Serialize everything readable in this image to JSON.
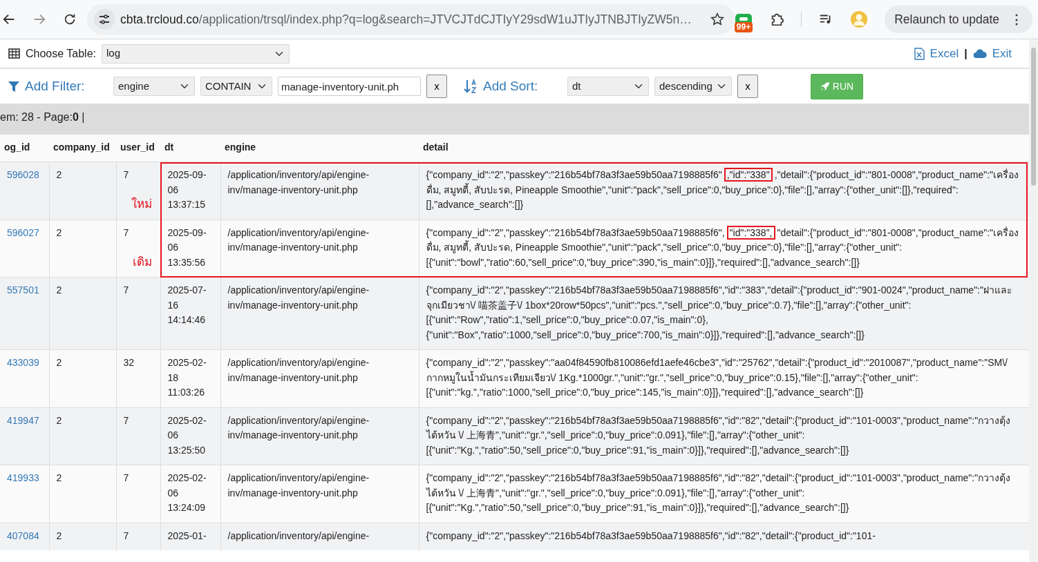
{
  "browser": {
    "url_domain": "cbta.trcloud.co",
    "url_path": "/application/trsql/index.php?q=log&search=JTVCJTdCJTIyY29sdW1uJTIyJTNBJTIyZW5n…",
    "badge": "99+",
    "relaunch_button": "Relaunch to update",
    "menu_glyph": "⋮"
  },
  "toolbar": {
    "choose_table_label": "Choose Table:",
    "table_select": "log",
    "links": [
      {
        "kind": "excel",
        "label": "Excel"
      },
      {
        "kind": "exit",
        "label": "Exit"
      }
    ],
    "separator": "|"
  },
  "filter": {
    "label": "Add Filter:",
    "column": "engine",
    "operator": "CONTAIN",
    "value": "manage-inventory-unit.ph",
    "remove": "x"
  },
  "sort": {
    "label": "Add Sort:",
    "column": "dt",
    "direction": "descending",
    "remove": "x"
  },
  "run_button": "RUN",
  "status": "em: 28 - Page:**0** |",
  "table": {
    "columns": [
      "og_id",
      "company_id",
      "user_id",
      "dt",
      "engine",
      "detail"
    ],
    "rows": [
      {
        "log_id": "596028",
        "company_id": "2",
        "user_id": "7",
        "annotation": "ใหม่",
        "boxed": true,
        "dt": "2025-09-06 13:37:15",
        "engine": "/application/inventory/api/engine-inv/manage-inventory-unit.php",
        "detail": {
          "before": "{\"company_id\":\"2\",\"passkey\":\"216b54bf78a3f3ae59b50aa7198885f6\"",
          "highlight": ",\"id\":\"338\"",
          "after": ",\"detail\":{\"product_id\":\"801-0008\",\"product_name\":\"เครื่องดื่ม, สมูทตี้, สับปะรด, Pineapple Smoothie\",\"unit\":\"pack\",\"sell_price\":0,\"buy_price\":0},\"file\":[],\"array\":{\"other_unit\":[]},\"required\":[],\"advance_search\":[]}"
        }
      },
      {
        "log_id": "596027",
        "company_id": "2",
        "user_id": "7",
        "annotation": "เดิม",
        "boxed": true,
        "dt": "2025-09-06 13:35:56",
        "engine": "/application/inventory/api/engine-inv/manage-inventory-unit.php",
        "detail": {
          "before": "{\"company_id\":\"2\",\"passkey\":\"216b54bf78a3f3ae59b50aa7198885f6\",",
          "highlight": "\"id\":\"338\",",
          "after": "\"detail\":{\"product_id\":\"801-0008\",\"product_name\":\"เครื่องดื่ม, สมูทตี้, สับปะรด, Pineapple Smoothie\",\"unit\":\"pack\",\"sell_price\":0,\"buy_price\":0},\"file\":[],\"array\":{\"other_unit\":[{\"unit\":\"bowl\",\"ratio\":60,\"sell_price\":0,\"buy_price\":390,\"is_main\":0}]},\"required\":[],\"advance_search\":[]}"
        }
      },
      {
        "log_id": "557501",
        "company_id": "2",
        "user_id": "7",
        "boxed": false,
        "dt": "2025-07-16 14:14:46",
        "engine": "/application/inventory/api/engine-inv/manage-inventory-unit.php",
        "detail": {
          "before": "{\"company_id\":\"2\",\"passkey\":\"216b54bf78a3f3ae59b50aa7198885f6\",\"id\":\"383\",\"detail\":{\"product_id\":\"901-0024\",\"product_name\":\"ฝาและจุกเมียวชา\\/ 喵茶盖子\\/ 1box*20row*50pcs\",\"unit\":\"pcs.\",\"sell_price\":0,\"buy_price\":0.7},\"file\":[],\"array\":{\"other_unit\":[{\"unit\":\"Row\",\"ratio\":1,\"sell_price\":0,\"buy_price\":0.07,\"is_main\":0},{\"unit\":\"Box\",\"ratio\":1000,\"sell_price\":0,\"buy_price\":700,\"is_main\":0}]},\"required\":[],\"advance_search\":[]}"
        }
      },
      {
        "log_id": "433039",
        "company_id": "2",
        "user_id": "32",
        "boxed": false,
        "dt": "2025-02-18 11:03:26",
        "engine": "/application/inventory/api/engine-inv/manage-inventory-unit.php",
        "detail": {
          "before": "{\"company_id\":\"2\",\"passkey\":\"aa04f84590fb810086efd1aefe46cbe3\",\"id\":\"25762\",\"detail\":{\"product_id\":\"2010087\",\"product_name\":\"SM\\/ กากหมูในน้ำมันกระเทียมเจียว\\/ 1Kg.*1000gr.\",\"unit\":\"gr.\",\"sell_price\":0,\"buy_price\":0.15},\"file\":[],\"array\":{\"other_unit\":[{\"unit\":\"kg.\",\"ratio\":1000,\"sell_price\":0,\"buy_price\":145,\"is_main\":0}]},\"required\":[],\"advance_search\":[]}"
        }
      },
      {
        "log_id": "419947",
        "company_id": "2",
        "user_id": "7",
        "boxed": false,
        "dt": "2025-02-06 13:25:50",
        "engine": "/application/inventory/api/engine-inv/manage-inventory-unit.php",
        "detail": {
          "before": "{\"company_id\":\"2\",\"passkey\":\"216b54bf78a3f3ae59b50aa7198885f6\",\"id\":\"82\",\"detail\":{\"product_id\":\"101-0003\",\"product_name\":\"กวางตุ้งไต้หวัน \\/ 上海青\",\"unit\":\"gr.\",\"sell_price\":0,\"buy_price\":0.091},\"file\":[],\"array\":{\"other_unit\":[{\"unit\":\"Kg.\",\"ratio\":50,\"sell_price\":0,\"buy_price\":91,\"is_main\":0}]},\"required\":[],\"advance_search\":[]}"
        }
      },
      {
        "log_id": "419933",
        "company_id": "2",
        "user_id": "7",
        "boxed": false,
        "dt": "2025-02-06 13:24:09",
        "engine": "/application/inventory/api/engine-inv/manage-inventory-unit.php",
        "detail": {
          "before": "{\"company_id\":\"2\",\"passkey\":\"216b54bf78a3f3ae59b50aa7198885f6\",\"id\":\"82\",\"detail\":{\"product_id\":\"101-0003\",\"product_name\":\"กวางตุ้งไต้หวัน \\/ 上海青\",\"unit\":\"gr.\",\"sell_price\":0,\"buy_price\":0.091},\"file\":[],\"array\":{\"other_unit\":[{\"unit\":\"Kg.\",\"ratio\":50,\"sell_price\":0,\"buy_price\":91,\"is_main\":0}]},\"required\":[],\"advance_search\":[]}"
        }
      },
      {
        "log_id": "407084",
        "company_id": "2",
        "user_id": "7",
        "boxed": false,
        "dt": "2025-01-",
        "engine": "/application/inventory/api/engine-",
        "detail": {
          "before": "{\"company_id\":\"2\",\"passkey\":\"216b54bf78a3f3ae59b50aa7198885f6\",\"id\":\"82\",\"detail\":{\"product_id\":\"101-"
        }
      }
    ]
  }
}
